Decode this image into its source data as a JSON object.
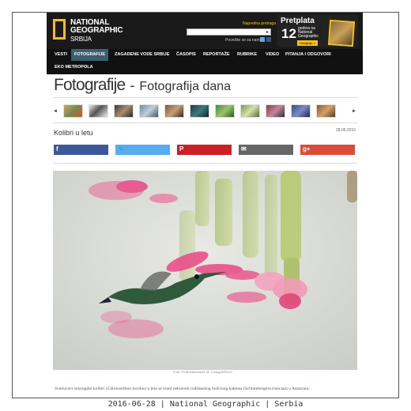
{
  "header": {
    "logo": {
      "line1": "NATIONAL",
      "line2": "GEOGRAPHIC",
      "line3": "SRBIJA"
    },
    "advanced_search": "Napredna pretraga",
    "search": {
      "value": ""
    },
    "connect_text": "Povežite se sa nama",
    "promo": {
      "title": "Pretplata",
      "number": "12",
      "text": "godina na National Geographic",
      "button": "Detaljnije »"
    }
  },
  "nav": {
    "items": [
      "VESTI",
      "FOTOGRAFIJE",
      "ZAGADENE VODE SRBIJE",
      "ČASOPIS",
      "REPORTAŽE",
      "RUBRIKE",
      "VIDEO",
      "PITANJA I ODGOVORI",
      "EKO METROPOLA"
    ],
    "active": "FOTOGRAFIJE"
  },
  "page": {
    "title": "Fotografije",
    "separator": "-",
    "subtitle": "Fotografija dana"
  },
  "gallery": {
    "prev_label": "◄",
    "next_label": "►"
  },
  "photo": {
    "title": "Kolibri u letu",
    "date": "28.06.2016",
    "credit": "Foto: Prolimedia/Andre M. Chang/ARDUO",
    "caption": "Svetlucavi smaragdni kolibri (Chlorostilbon lucidus) u letu se hrani nektarom rođdanskog božićnog kaktusa (Schlumbergera truncata) u Amazonu."
  },
  "share": {
    "facebook": "f",
    "twitter": "🐦",
    "pinterest": "P",
    "email": "✉",
    "google": "g+",
    "colors": {
      "facebook": "#3b5998",
      "twitter": "#55acee",
      "pinterest": "#cb2027",
      "email": "#666666",
      "google": "#dd4b39"
    }
  },
  "footer_caption": "2016-06-28 | National Geographic | Serbia"
}
